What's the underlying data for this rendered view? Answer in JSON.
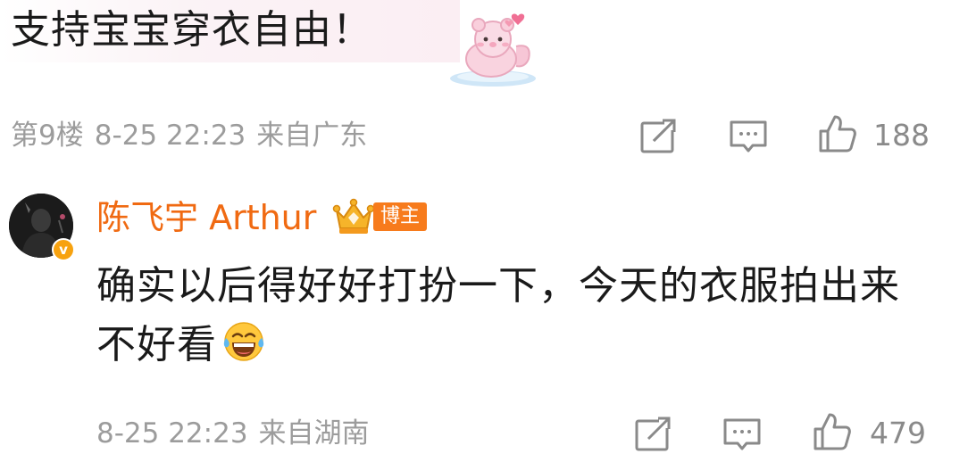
{
  "comment1": {
    "text": "支持宝宝穿衣自由！",
    "sticker_icon": "pink-bear-sticker",
    "floor": "第9楼",
    "date": "8-25 22:23",
    "location": "来自广东",
    "likes": "188"
  },
  "reply": {
    "username": "陈飞宇 Arthur",
    "badge": "博主",
    "badge_icon": "crown-icon",
    "verified_mark": "v",
    "text": "确实以后得好好打扮一下，今天的衣服拍出来不好看",
    "emoji": "laughing-tears-emoji",
    "date": "8-25 22:23",
    "location": "来自湖南",
    "likes": "479"
  },
  "colors": {
    "username": "#f06a12",
    "badge": "#f77b1c",
    "meta": "#9c9c9c",
    "text": "#1a1a1a"
  }
}
